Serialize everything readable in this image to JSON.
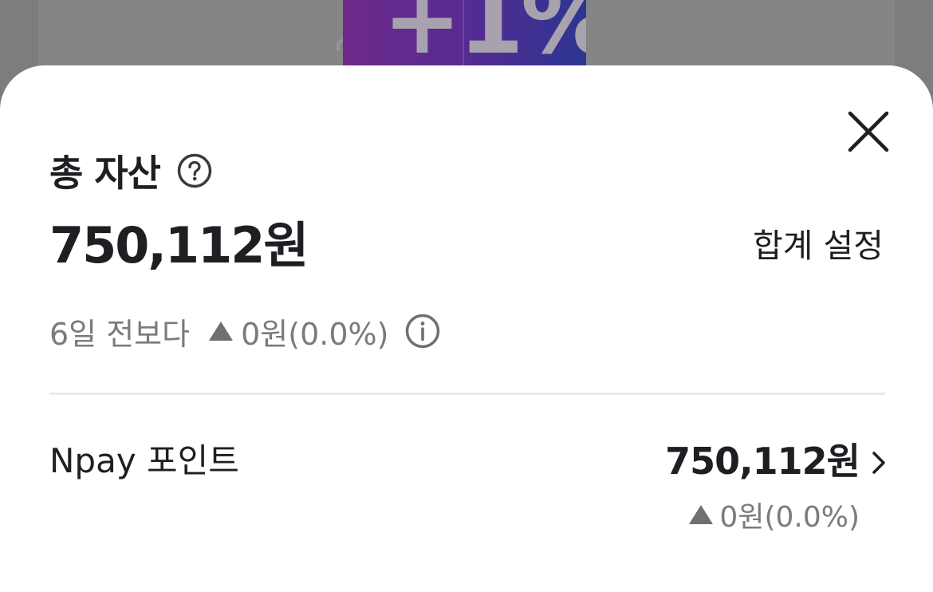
{
  "background": {
    "promo_text": "+1%"
  },
  "sheet": {
    "title": "총 자산",
    "total_amount": "750,112원",
    "sum_settings_label": "합계 설정",
    "change_prefix": "6일 전보다",
    "change_value": "0원(0.0%)",
    "change_direction": "up",
    "icons": {
      "close": "close-icon",
      "help": "question-circle-icon",
      "info": "info-circle-icon",
      "chevron": "chevron-right-icon",
      "trend": "triangle-up-icon"
    }
  },
  "assets": [
    {
      "label": "Npay 포인트",
      "amount": "750,112원",
      "change_value": "0원(0.0%)"
    }
  ],
  "colors": {
    "text_primary": "#1e1e23",
    "text_secondary": "#7a7a80",
    "overlay": "#7f7f80",
    "promo_gradient_start": "#6c2a8a",
    "promo_gradient_end": "#2c3592"
  }
}
